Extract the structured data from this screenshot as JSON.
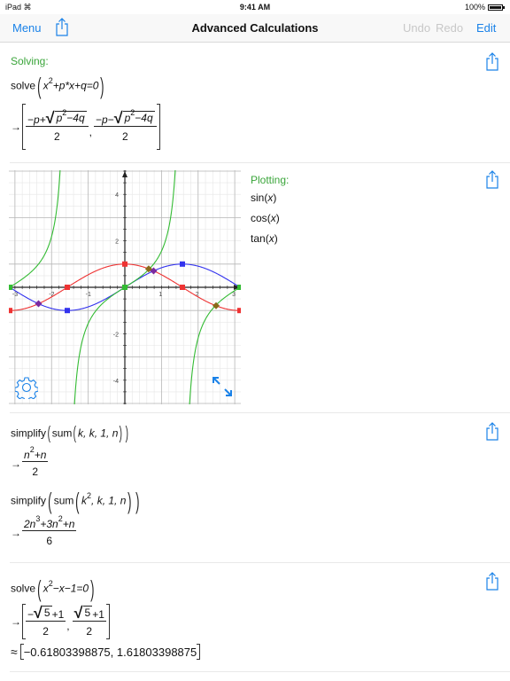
{
  "status_bar": {
    "device": "iPad",
    "time": "9:41 AM",
    "battery": "100%",
    "battery_level": 1.0
  },
  "nav": {
    "menu_label": "Menu",
    "title": "Advanced Calculations",
    "undo_label": "Undo",
    "redo_label": "Redo",
    "edit_label": "Edit",
    "share_icon": "share-icon"
  },
  "colors": {
    "accent": "#1a82e8",
    "heading": "#3aa53a",
    "disabled": "#c8c8c8",
    "sin": "#3333ee",
    "cos": "#ee3333",
    "tan": "#33bb33"
  },
  "sections": [
    {
      "heading": "Solving:",
      "input": {
        "fn": "solve",
        "x": "x",
        "exp": "2",
        "rest": "+p*x+q=0"
      },
      "result": {
        "arrow": "→",
        "items": [
          {
            "neg": "−p+",
            "rad_base": "p",
            "rad_exp": "2",
            "rad_rest": "−4q",
            "den": "2"
          },
          {
            "neg": "−p−",
            "rad_base": "p",
            "rad_exp": "2",
            "rad_rest": "−4q",
            "den": "2"
          }
        ],
        "comma": ","
      }
    },
    {
      "heading": "Plotting:",
      "functions": [
        {
          "name": "sin",
          "arg": "x"
        },
        {
          "name": "cos",
          "arg": "x"
        },
        {
          "name": "tan",
          "arg": "x"
        }
      ],
      "settings_icon": "gear-icon",
      "expand_icon": "expand-arrows-icon"
    },
    {
      "lines": [
        {
          "input": "simplify(sum(k, k, 1, n))",
          "fn1": "simplify",
          "fn2": "sum",
          "args": "k, k, 1, n",
          "result_num": {
            "base": "n",
            "exp": "2",
            "rest": "+n"
          },
          "result_den": "2"
        },
        {
          "input": "simplify(sum(k^2, k, 1, n))",
          "fn1": "simplify",
          "fn2": "sum",
          "arg_base": "k",
          "arg_exp": "2",
          "args_rest": ", k, 1, n",
          "result_num": {
            "a": "2n",
            "a_exp": "3",
            "b": "+3n",
            "b_exp": "2",
            "c": "+n"
          },
          "result_den": "6"
        }
      ]
    },
    {
      "input": {
        "fn": "solve",
        "x": "x",
        "exp": "2",
        "rest": "−x−1=0"
      },
      "result": {
        "items": [
          {
            "pre": "−",
            "rad": "5",
            "post": "+1",
            "den": "2"
          },
          {
            "pre": "",
            "rad": "5",
            "post": "+1",
            "den": "2"
          }
        ]
      },
      "approx_symbol": "≈",
      "approx": "−0.61803398875, 1.61803398875"
    }
  ],
  "chart_data": {
    "type": "line",
    "title": "",
    "xlabel": "",
    "ylabel": "",
    "xlim": [
      -3.1416,
      3.1416
    ],
    "ylim": [
      -5,
      5
    ],
    "grid": true,
    "x_ticks": [
      "-3",
      "-2",
      "-1",
      "1",
      "2",
      "3"
    ],
    "x_tick_values": [
      -3,
      -2,
      -1,
      1,
      2,
      3
    ],
    "y_ticks": [
      "4",
      "2",
      "-2",
      "-4"
    ],
    "y_tick_values": [
      4,
      2,
      -2,
      -4
    ],
    "series": [
      {
        "name": "sin(x)",
        "fn": "sin",
        "color": "#3333ee",
        "markers": [
          [
            -3.1416,
            0
          ],
          [
            -1.5708,
            -1
          ],
          [
            0,
            0
          ],
          [
            1.5708,
            1
          ],
          [
            3.1416,
            0
          ]
        ]
      },
      {
        "name": "cos(x)",
        "fn": "cos",
        "color": "#ee3333",
        "markers": [
          [
            -3.1416,
            -1
          ],
          [
            -1.5708,
            0
          ],
          [
            0,
            1
          ],
          [
            1.5708,
            0
          ],
          [
            3.1416,
            -1
          ]
        ]
      },
      {
        "name": "tan(x)",
        "fn": "tan",
        "color": "#33bb33",
        "markers": [
          [
            -3.1416,
            0
          ],
          [
            0,
            0
          ],
          [
            3.1416,
            0
          ]
        ]
      }
    ],
    "intersections": [
      {
        "x": -2.356,
        "y": -0.707,
        "color": "#7a2aa0"
      },
      {
        "x": 0.785,
        "y": 0.707,
        "color": "#7a2aa0"
      },
      {
        "x": 0.65,
        "y": 0.79,
        "color": "#8a6a1a"
      },
      {
        "x": 2.49,
        "y": -0.79,
        "color": "#8a6a1a"
      }
    ]
  }
}
